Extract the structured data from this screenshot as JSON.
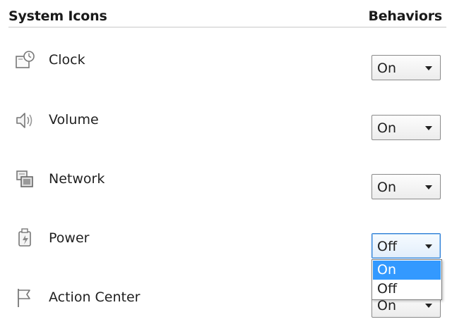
{
  "header": {
    "left_label": "System Icons",
    "right_label": "Behaviors"
  },
  "rows": [
    {
      "name": "Clock",
      "icon": "clock-icon",
      "value": "On"
    },
    {
      "name": "Volume",
      "icon": "volume-icon",
      "value": "On"
    },
    {
      "name": "Network",
      "icon": "network-icon",
      "value": "On"
    },
    {
      "name": "Power",
      "icon": "power-icon",
      "value": "Off"
    },
    {
      "name": "Action Center",
      "icon": "action-center-flag-icon",
      "value": "On"
    }
  ],
  "open_dropdown": {
    "row": "Power",
    "options": [
      "On",
      "Off"
    ],
    "highlighted": "On"
  },
  "colors": {
    "highlight": "#3399ff",
    "focus_border": "#2f7fd6",
    "icon_gray": "#7a7a7a"
  }
}
